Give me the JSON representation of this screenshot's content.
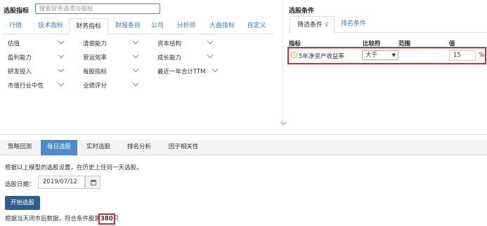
{
  "left_panel": {
    "title": "选股指标",
    "search_placeholder": "搜索财务选项与指标",
    "tabs": [
      "行情",
      "技术指标",
      "财务指标",
      "财报条目",
      "公司",
      "分析师",
      "大盘指标",
      "自定义"
    ],
    "active_tab": "财务指标",
    "categories": [
      {
        "label": "估值"
      },
      {
        "label": "清偿能力"
      },
      {
        "label": "资本结构"
      },
      {
        "label": "盈利能力"
      },
      {
        "label": "营运效率"
      },
      {
        "label": "成长能力"
      },
      {
        "label": "研发投入"
      },
      {
        "label": "每股指标"
      },
      {
        "label": "最近一年合计TTM"
      },
      {
        "label": "市值行业中性"
      },
      {
        "label": "业绩评分"
      }
    ]
  },
  "right_panel": {
    "title": "选股条件",
    "tabs": [
      "筛选条件",
      "排名条件"
    ],
    "active_tab": "筛选条件",
    "headers": {
      "indicator": "指标",
      "compare": "比较符",
      "range": "范围",
      "value": "值"
    },
    "condition": {
      "name": "5年净资产收益率",
      "operator": "大于",
      "value": "15",
      "unit": "%"
    }
  },
  "bottom": {
    "tabs": [
      "策略回测",
      "每日选股",
      "实时选股",
      "排名分析",
      "因子相关性"
    ],
    "active_tab": "每日选股",
    "instruction": "根据以上模型的选股设置，在历史上任何一天选股。",
    "date_label": "选股日期：",
    "date_value": "2019/07/12",
    "start_button": "开始选股",
    "result_prefix": "根据当天闭市后数据，符合条件股票",
    "result_count": "380",
    "result_suffix": "只"
  },
  "colors": {
    "accent": "#4a8cc9",
    "button": "#2e5e8e",
    "highlight": "#e3272d",
    "link": "#3a7bc8"
  }
}
